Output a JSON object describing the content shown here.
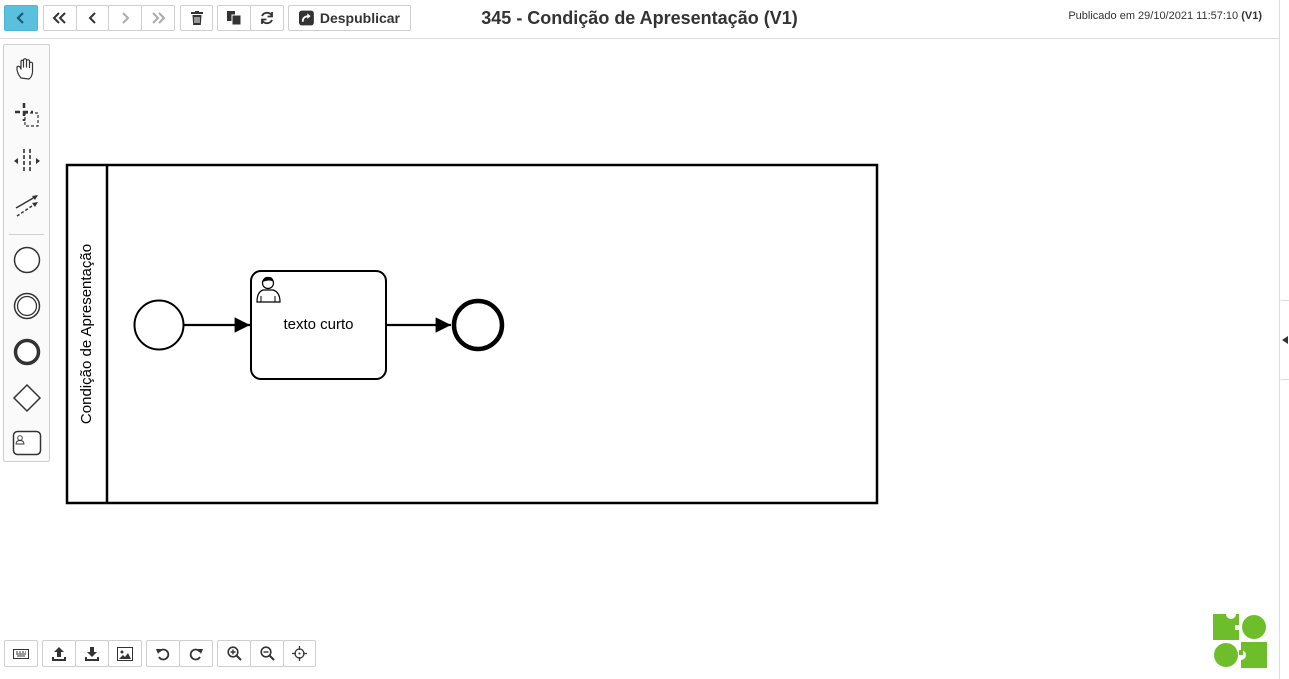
{
  "header": {
    "title": "345 - Condição de Apresentação (V1)",
    "published_prefix": "Publicado em 29/10/2021 11:57:10",
    "published_version": "(V1)",
    "unpublish_label": "Despublicar"
  },
  "toolbar": {
    "icons": [
      "chevron-left-icon",
      "double-chevron-left-icon",
      "chevron-left-icon",
      "chevron-right-icon",
      "double-chevron-right-icon",
      "trash-icon",
      "copy-icon",
      "refresh-icon",
      "share-icon"
    ]
  },
  "palette": {
    "tools": [
      "hand-tool",
      "lasso-tool",
      "space-tool",
      "connect-tool",
      "start-event",
      "intermediate-event",
      "end-event",
      "gateway",
      "user-task"
    ]
  },
  "diagram": {
    "pool_label": "Condição de Apresentação",
    "task_label": "texto curto",
    "elements": [
      "start-event",
      "user-task",
      "end-event"
    ],
    "flows": [
      {
        "from": "start-event",
        "to": "user-task"
      },
      {
        "from": "user-task",
        "to": "end-event"
      }
    ]
  },
  "bottom_toolbar": {
    "icons": [
      "keyboard-icon",
      "upload-icon",
      "download-icon",
      "image-icon",
      "undo-icon",
      "redo-icon",
      "zoom-in-icon",
      "zoom-out-icon",
      "center-icon"
    ]
  },
  "colors": {
    "back_button": "#5bc0de",
    "logo_green": "#6dbe2a"
  }
}
